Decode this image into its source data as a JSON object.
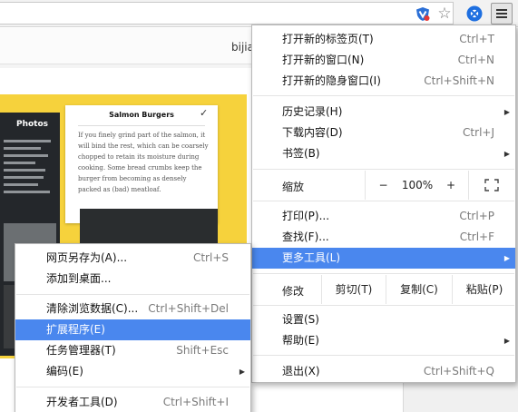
{
  "browser": {
    "site_text": "bijia",
    "icons": {
      "extension": "shield-v-icon",
      "bookmark": "star-icon",
      "logo": "chrome-logo-icon",
      "menu": "hamburger-menu-icon"
    }
  },
  "page": {
    "card_title": "Salmon Burgers",
    "card_body": "If you finely grind part of the salmon, it will bind the rest, which can be coarsely chopped to retain its moisture during cooking. Some bread crumbs keep the burger from becoming as densely packed as (bad) meatloaf.",
    "photos_label": "Photos"
  },
  "main_menu": {
    "new_tab": {
      "label": "打开新的标签页(T)",
      "shortcut": "Ctrl+T"
    },
    "new_window": {
      "label": "打开新的窗口(N)",
      "shortcut": "Ctrl+N"
    },
    "incognito": {
      "label": "打开新的隐身窗口(I)",
      "shortcut": "Ctrl+Shift+N"
    },
    "history": {
      "label": "历史记录(H)"
    },
    "downloads": {
      "label": "下载内容(D)",
      "shortcut": "Ctrl+J"
    },
    "bookmarks": {
      "label": "书签(B)"
    },
    "zoom": {
      "label": "缩放",
      "minus": "−",
      "value": "100%",
      "plus": "+"
    },
    "print": {
      "label": "打印(P)...",
      "shortcut": "Ctrl+P"
    },
    "find": {
      "label": "查找(F)...",
      "shortcut": "Ctrl+F"
    },
    "more_tools": {
      "label": "更多工具(L)"
    },
    "edit": {
      "label": "修改",
      "cut": "剪切(T)",
      "copy": "复制(C)",
      "paste": "粘贴(P)"
    },
    "settings": {
      "label": "设置(S)"
    },
    "help": {
      "label": "帮助(E)"
    },
    "exit": {
      "label": "退出(X)",
      "shortcut": "Ctrl+Shift+Q"
    }
  },
  "sub_menu": {
    "save_as": {
      "label": "网页另存为(A)...",
      "shortcut": "Ctrl+S"
    },
    "add_desktop": {
      "label": "添加到桌面..."
    },
    "clear_data": {
      "label": "清除浏览数据(C)...",
      "shortcut": "Ctrl+Shift+Del"
    },
    "extensions": {
      "label": "扩展程序(E)"
    },
    "task_manager": {
      "label": "任务管理器(T)",
      "shortcut": "Shift+Esc"
    },
    "encoding": {
      "label": "编码(E)"
    },
    "devtools": {
      "label": "开发者工具(D)",
      "shortcut": "Ctrl+Shift+I"
    }
  },
  "colors": {
    "highlight": "#4a87ee",
    "yellow": "#f6d23c"
  }
}
